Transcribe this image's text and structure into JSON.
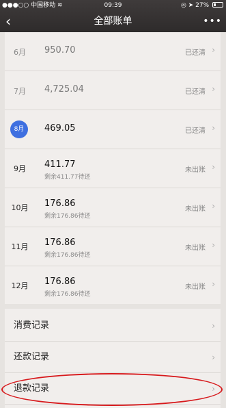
{
  "status_bar": {
    "carrier": "中国移动",
    "time": "09:39",
    "battery": "27%",
    "battery_level": 0.27
  },
  "nav": {
    "back_icon": "chevron-left-icon",
    "title": "全部账单",
    "more_icon": "more-dots-icon",
    "more_glyph": "•••"
  },
  "bills": [
    {
      "month": "6月",
      "amount": "950.70",
      "remain": "",
      "status": "已还清",
      "state": "paid"
    },
    {
      "month": "7月",
      "amount": "4,725.04",
      "remain": "",
      "status": "已还清",
      "state": "paid"
    },
    {
      "month": "8月",
      "amount": "469.05",
      "remain": "",
      "status": "已还清",
      "state": "current"
    },
    {
      "month": "9月",
      "amount": "411.77",
      "remain": "剩余411.77待还",
      "status": "未出账",
      "state": "upcoming"
    },
    {
      "month": "10月",
      "amount": "176.86",
      "remain": "剩余176.86待还",
      "status": "未出账",
      "state": "upcoming"
    },
    {
      "month": "11月",
      "amount": "176.86",
      "remain": "剩余176.86待还",
      "status": "未出账",
      "state": "upcoming"
    },
    {
      "month": "12月",
      "amount": "176.86",
      "remain": "剩余176.86待还",
      "status": "未出账",
      "state": "upcoming"
    }
  ],
  "records": [
    {
      "label": "消费记录"
    },
    {
      "label": "还款记录"
    },
    {
      "label": "退款记录"
    }
  ],
  "colors": {
    "current_month_badge": "#3e6fe0",
    "annotation_circle": "#d7191c"
  }
}
